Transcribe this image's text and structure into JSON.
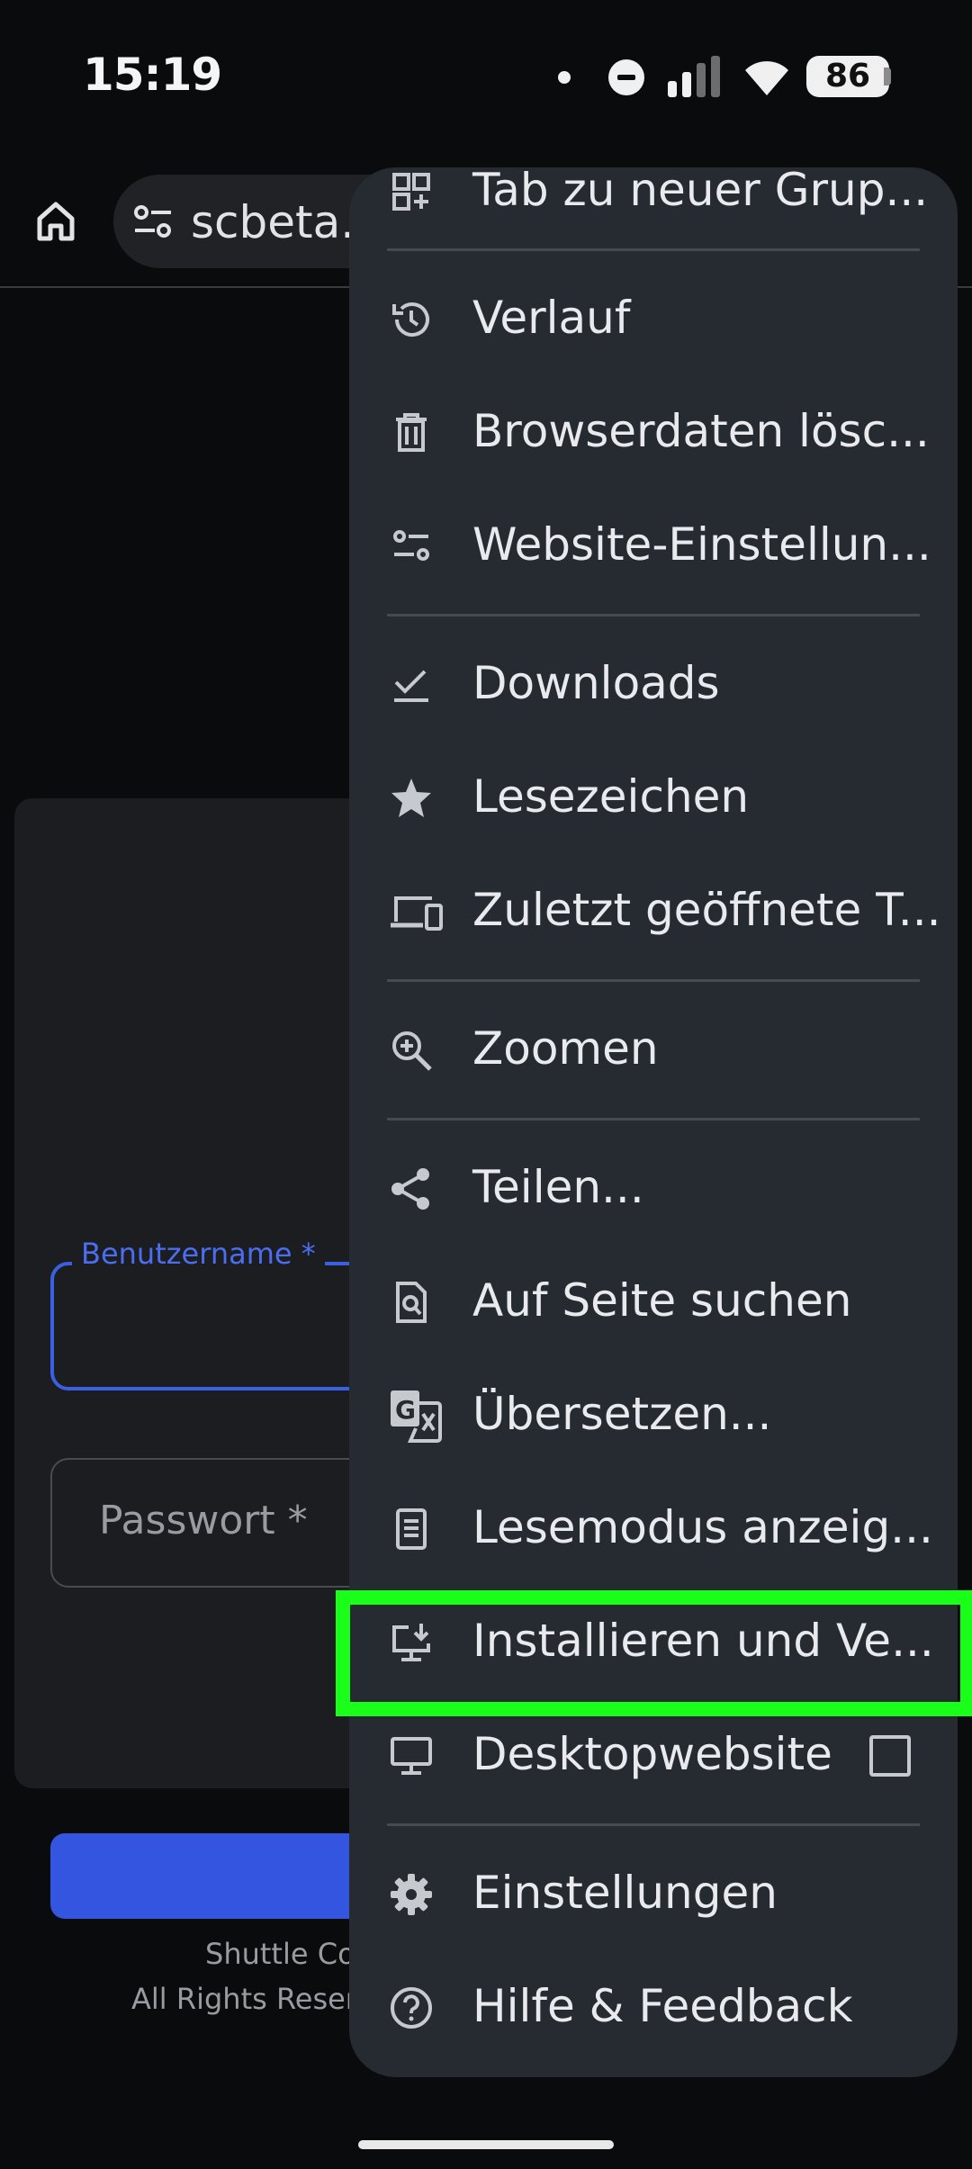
{
  "status_bar": {
    "time": "15:19",
    "battery": "86"
  },
  "toolbar": {
    "url": "scbeta.",
    "icons": [
      "home-icon",
      "tune-icon"
    ]
  },
  "page": {
    "username_label": "Benutzername *",
    "password_placeholder": "Passwort *",
    "footer_line1": "Shuttle Cor",
    "footer_line2": "All Rights Reserv"
  },
  "menu": {
    "items": [
      {
        "label": "Tab zu neuer Grup...",
        "icon": "tab-group-icon"
      },
      {
        "label": "Verlauf",
        "icon": "history-icon"
      },
      {
        "label": "Browserdaten lösc...",
        "icon": "trash-icon"
      },
      {
        "label": "Website-Einstellun...",
        "icon": "site-settings-icon"
      },
      {
        "label": "Downloads",
        "icon": "download-check-icon"
      },
      {
        "label": "Lesezeichen",
        "icon": "star-icon"
      },
      {
        "label": "Zuletzt geöffnete T...",
        "icon": "devices-icon"
      },
      {
        "label": "Zoomen",
        "icon": "zoom-icon"
      },
      {
        "label": "Teilen...",
        "icon": "share-icon"
      },
      {
        "label": "Auf Seite suchen",
        "icon": "find-in-page-icon"
      },
      {
        "label": "Übersetzen...",
        "icon": "translate-icon"
      },
      {
        "label": "Lesemodus anzeig...",
        "icon": "reader-mode-icon"
      },
      {
        "label": "Installieren und Ve...",
        "icon": "install-icon"
      },
      {
        "label": "Desktopwebsite",
        "icon": "desktop-icon",
        "checkbox": false
      },
      {
        "label": "Einstellungen",
        "icon": "gear-icon"
      },
      {
        "label": "Hilfe & Feedback",
        "icon": "help-icon"
      }
    ]
  },
  "highlight_color": "#1aff1a",
  "accent_color": "#3355e0"
}
